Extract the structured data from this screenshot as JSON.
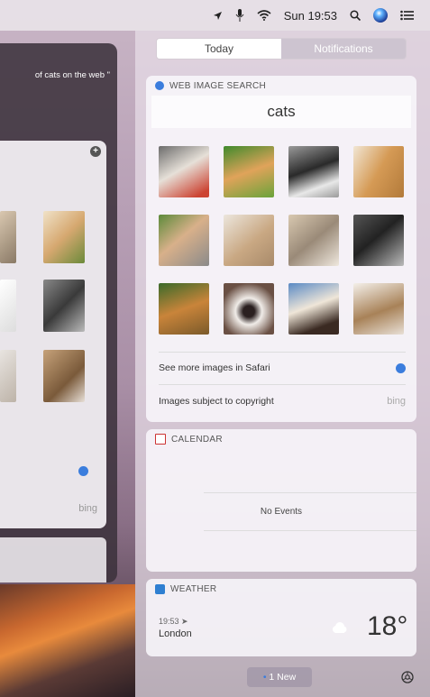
{
  "menubar": {
    "clock": "Sun 19:53",
    "icons": [
      "location-arrow-icon",
      "microphone-icon",
      "wifi-icon",
      "search-icon",
      "siri-icon",
      "notification-center-icon"
    ]
  },
  "siri": {
    "query": "of cats on the web \""
  },
  "notification_center": {
    "tabs": {
      "today": "Today",
      "notifications": "Notifications"
    },
    "active_tab": "Today",
    "web_image_search": {
      "title": "WEB IMAGE SEARCH",
      "query": "cats",
      "see_more": "See more images in Safari",
      "copyright": "Images subject to copyright",
      "provider": "bing"
    },
    "calendar": {
      "title": "CALENDAR",
      "empty_text": "No Events"
    },
    "weather": {
      "title": "WEATHER",
      "time": "19:53",
      "city": "London",
      "temperature": "18°",
      "condition_icon": "cloud-icon"
    },
    "footer": {
      "new_count": "1 New"
    }
  },
  "colors": {
    "accent_blue": "#3b7ddd",
    "calendar_red": "#cc3333",
    "weather_blue": "#2f7fd1"
  }
}
